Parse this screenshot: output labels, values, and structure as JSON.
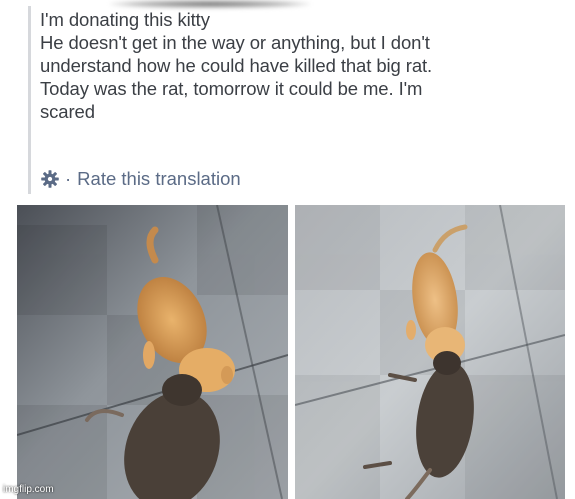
{
  "post": {
    "lines": [
      "I'm donating this kitty",
      "He doesn't get in the way or anything, but I don't",
      "understand how he could have killed that big rat.",
      "Today was the rat, tomorrow it could be me. I'm",
      "scared"
    ],
    "rate_translation": "Rate this translation",
    "rate_separator": "·",
    "rate_icon": "gear-icon"
  },
  "photos": [
    {
      "subject": "kitten-with-rat-photo-1"
    },
    {
      "subject": "kitten-with-rat-photo-2"
    }
  ],
  "watermark": "imgflip.com"
}
